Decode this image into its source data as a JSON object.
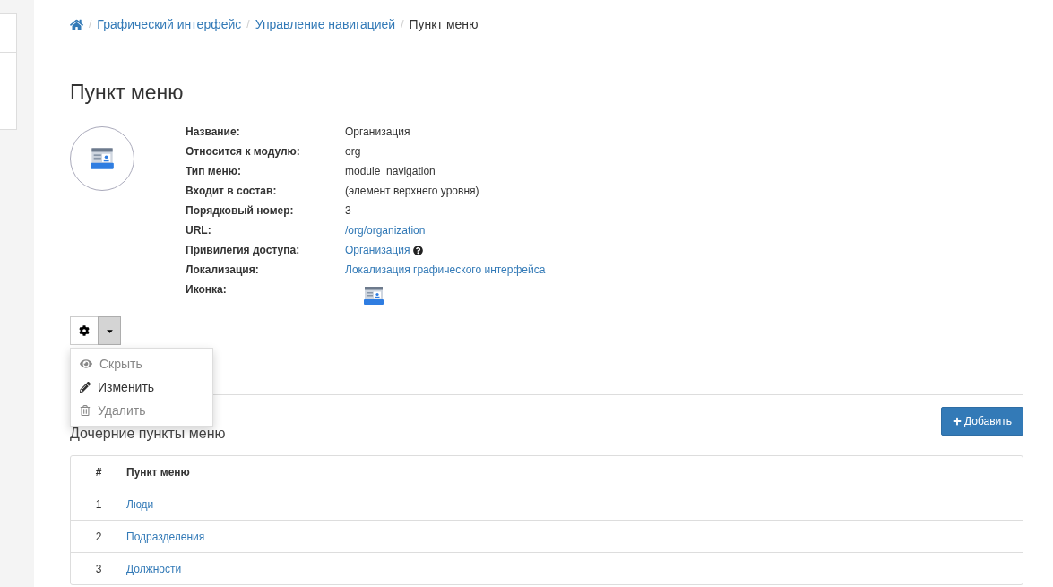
{
  "breadcrumb": {
    "separator": "/",
    "items": [
      "Графический интерфейс",
      "Управление навигацией"
    ],
    "current": "Пункт меню"
  },
  "title": "Пункт меню",
  "details": [
    {
      "label": "Название:",
      "value": "Организация",
      "kind": "text"
    },
    {
      "label": "Относится к модулю:",
      "value": "org",
      "kind": "text"
    },
    {
      "label": "Тип меню:",
      "value": "module_navigation",
      "kind": "text"
    },
    {
      "label": "Входит в состав:",
      "value": "(элемент верхнего уровня)",
      "kind": "text"
    },
    {
      "label": "Порядковый номер:",
      "value": "3",
      "kind": "text"
    },
    {
      "label": "URL:",
      "value": "/org/organization",
      "kind": "link"
    },
    {
      "label": "Привилегия доступа:",
      "value": "Организация",
      "kind": "link-help"
    },
    {
      "label": "Локализация:",
      "value": "Локализация графического интерфейса",
      "kind": "link"
    },
    {
      "label": "Иконка:",
      "kind": "icon"
    }
  ],
  "actions_menu": {
    "expanded": true,
    "items": [
      {
        "label": "Скрыть",
        "kind": "hide",
        "disabled": true
      },
      {
        "label": "Изменить",
        "kind": "edit",
        "disabled": false
      },
      {
        "label": "Удалить",
        "kind": "delete",
        "disabled": true
      }
    ]
  },
  "children_section": {
    "title": "Дочерние пункты меню",
    "add_button": "Добавить",
    "columns": [
      "#",
      "Пункт меню"
    ],
    "rows": [
      {
        "number": "1",
        "name": "Люди"
      },
      {
        "number": "2",
        "name": "Подразделения"
      },
      {
        "number": "3",
        "name": "Должности"
      }
    ]
  }
}
